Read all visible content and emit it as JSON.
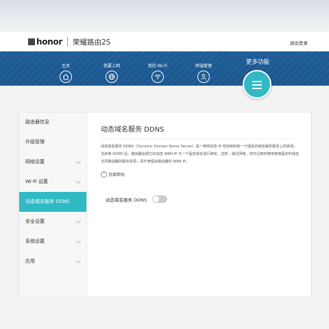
{
  "header": {
    "logo_text": "honor",
    "product": "荣耀路由2S",
    "logout": "退出登录"
  },
  "nav": {
    "items": [
      {
        "label": "主页",
        "icon": "home-icon"
      },
      {
        "label": "我要上网",
        "icon": "globe-icon"
      },
      {
        "label": "我的 Wi-Fi",
        "icon": "wifi-icon"
      },
      {
        "label": "终端管理",
        "icon": "user-icon"
      }
    ],
    "more_label": "更多功能",
    "more_icon": "menu-icon"
  },
  "sidebar": {
    "items": [
      {
        "label": "路由器信息",
        "expandable": false
      },
      {
        "label": "升级管理",
        "expandable": false
      },
      {
        "label": "网络设置",
        "expandable": true
      },
      {
        "label": "Wi-Fi 设置",
        "expandable": true
      },
      {
        "label": "动态域名服务 DDNS",
        "expandable": false,
        "active": true
      },
      {
        "label": "安全设置",
        "expandable": true
      },
      {
        "label": "系统设置",
        "expandable": true
      },
      {
        "label": "应用",
        "expandable": true
      }
    ]
  },
  "content": {
    "title": "动态域名服务 DDNS",
    "description": "动态域名服务 DDNS（Dynamic Domain Name Server）是一种将动态 IP 地址映射到一个固定的域名解析服务上的系统。当启用 DDNS 后，路由器会把它的动态 WAN IP 与一个固定域名进行绑定。这样，通过网络，您可以随时随地使用固定的域名访问路由器的服务资源，而不用理会路由器的 WAN IP。",
    "help": "页面帮助",
    "ddns_label": "动态域名服务 DDNS",
    "ddns_enabled": false
  },
  "colors": {
    "navbar": "#1b5a94",
    "accent": "#2fbac6"
  }
}
